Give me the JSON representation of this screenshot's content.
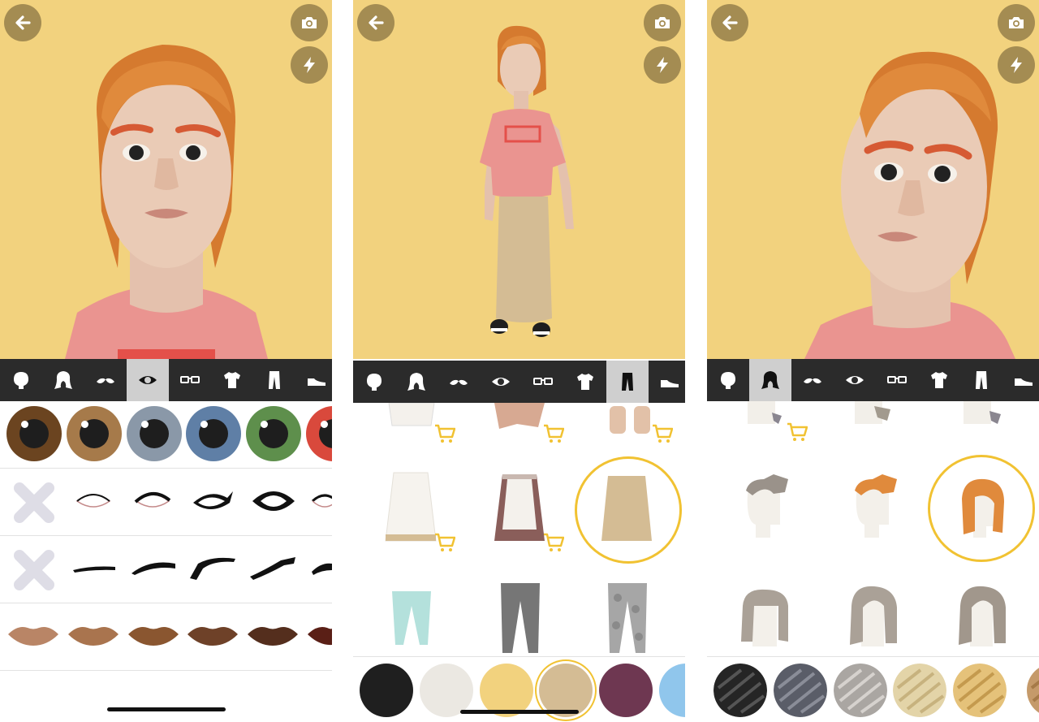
{
  "toolbar_categories": [
    "head-shape",
    "hair",
    "facial-hair",
    "eyes",
    "glasses",
    "tops",
    "bottoms",
    "shoes"
  ],
  "panels": [
    {
      "selected_category": "eyes"
    },
    {
      "selected_category": "bottoms"
    },
    {
      "selected_category": "hair"
    }
  ],
  "colors": {
    "background": "#f2d27e",
    "toolbar": "#2b2b2b",
    "toolbar_selected": "#cfcfcf",
    "round_button": "#a48c52",
    "selection_ring": "#f1c232",
    "cart": "#f1c232"
  },
  "eye_colors": [
    "#6b4420",
    "#a67a4a",
    "#8a98a8",
    "#5f7fa6",
    "#5e8f4c",
    "#d9493c"
  ],
  "lip_colors": [
    "#b98566",
    "#a9744e",
    "#8a5630",
    "#6e4128",
    "#542e1d",
    "#5a1f16"
  ],
  "bottoms_swatches": [
    "#1f1f1f",
    "#ebe8e2",
    "#f2d27e",
    "#d4bc94",
    "#6e3751",
    "#90c6ec"
  ],
  "hair_swatches": [
    "#252525",
    "#5a5d68",
    "#aaa6a2",
    "#e3d4a8",
    "#e5c27a",
    "#c59a6a"
  ]
}
